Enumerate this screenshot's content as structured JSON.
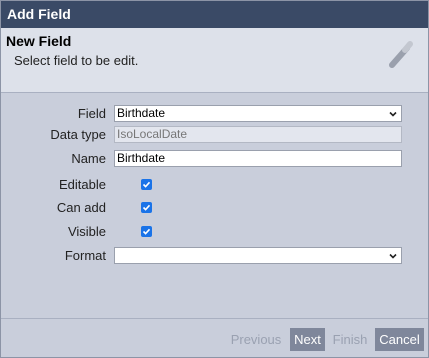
{
  "dialog": {
    "title": "Add Field",
    "header_title": "New Field",
    "header_subtitle": "Select field to be edit."
  },
  "form": {
    "field": {
      "label": "Field",
      "value": "Birthdate"
    },
    "data_type": {
      "label": "Data type",
      "value": "IsoLocalDate"
    },
    "name": {
      "label": "Name",
      "value": "Birthdate"
    },
    "editable": {
      "label": "Editable",
      "checked": true
    },
    "can_add": {
      "label": "Can add",
      "checked": true
    },
    "visible": {
      "label": "Visible",
      "checked": true
    },
    "format": {
      "label": "Format",
      "value": ""
    }
  },
  "footer": {
    "previous": "Previous",
    "next": "Next",
    "finish": "Finish",
    "cancel": "Cancel"
  },
  "colors": {
    "titlebar": "#3a4a66",
    "dialog_bg": "#c9cedb",
    "header_bg": "#dde1ea",
    "checkbox": "#1a73e8",
    "button_active": "#7f879b"
  },
  "icons": {
    "header": "magic-wand-icon",
    "dropdown": "chevron-down-icon",
    "checkbox": "checkmark-icon"
  }
}
